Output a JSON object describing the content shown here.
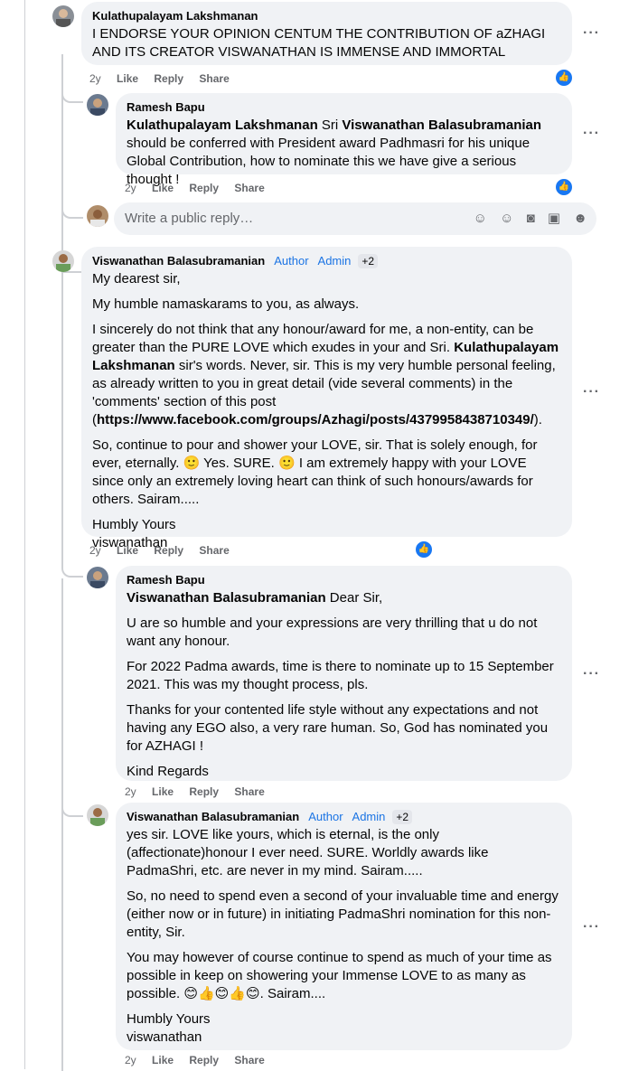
{
  "c1": {
    "author": "Kulathupalayam Lakshmanan",
    "text": "I ENDORSE YOUR OPINION CENTUM THE CONTRIBUTION OF aZHAGI AND ITS CREATOR VISWANATHAN IS IMMENSE AND IMMORTAL",
    "time": "2y",
    "like": "Like",
    "reply": "Reply",
    "share": "Share"
  },
  "c2": {
    "author": "Ramesh Bapu",
    "mention": "Kulathupalayam Lakshmanan",
    "t1": " Sri ",
    "mention2": "Viswanathan Balasubramanian",
    "t2": " should be conferred with President award Padhmasri for his unique Global Contribution, how to nominate this we have give a serious thought !",
    "time": "2y",
    "like": "Like",
    "reply": "Reply",
    "share": "Share"
  },
  "reply_box": {
    "placeholder": "Write a public reply…"
  },
  "c3": {
    "author": "Viswanathan Balasubramanian",
    "badge1": "Author",
    "badge2": "Admin",
    "plus": "+2",
    "p1": "My dearest sir,",
    "p2": "My humble namaskarams to you, as always.",
    "p3a": "I sincerely do not think that any honour/award for me, a non-entity, can be greater than the PURE LOVE which exudes in your and Sri. ",
    "p3b": "Kulathupalayam Lakshmanan",
    "p3c": " sir's words. Never, sir. This is my very humble personal feeling, as already written to you in great detail (vide several comments) in the 'comments' section of this post (",
    "p3d": "https://www.facebook.com/groups/Azhagi/posts/4379958438710349/",
    "p3e": ").",
    "p4": "So, continue to pour and shower your LOVE, sir. That is solely enough, for ever, eternally. 🙂 Yes. SURE. 🙂 I am extremely happy with your LOVE since only an extremely loving heart can think of such honours/awards for others. Sairam.....",
    "p5a": "Humbly Yours",
    "p5b": "viswanathan",
    "time": "2y",
    "like": "Like",
    "reply": "Reply",
    "share": "Share"
  },
  "c4": {
    "author": "Ramesh Bapu",
    "mention": "Viswanathan Balasubramanian",
    "p1": " Dear Sir,",
    "p2": "U are so humble and your expressions are very thrilling that u do not want any honour.",
    "p3": "For 2022 Padma awards, time is there to nominate up to 15 September 2021. This was my thought process, pls.",
    "p4": "Thanks for your contented life style without any expectations and not having any EGO also, a very rare human. So, God has nominated you for AZHAGI !",
    "p5": "Kind Regards",
    "time": "2y",
    "like": "Like",
    "reply": "Reply",
    "share": "Share"
  },
  "c5": {
    "author": "Viswanathan Balasubramanian",
    "badge1": "Author",
    "badge2": "Admin",
    "plus": "+2",
    "p1": "yes sir. LOVE like yours, which is eternal, is the only (affectionate)honour I ever need. SURE. Worldly awards like PadmaShri, etc. are never in my mind. Sairam.....",
    "p2": "So, no need to spend even a second of your invaluable time and energy (either now or in future) in initiating PadmaShri nomination for this non-entity, Sir.",
    "p3": "You may however of course continue to spend as much of your time as possible in keep on showering your Immense LOVE to as many as possible. 😊👍😊👍😊. Sairam....",
    "p4a": "Humbly Yours",
    "p4b": "viswanathan",
    "time": "2y",
    "like": "Like",
    "reply": "Reply",
    "share": "Share"
  },
  "more_icon": "···",
  "like_icon": "👍"
}
